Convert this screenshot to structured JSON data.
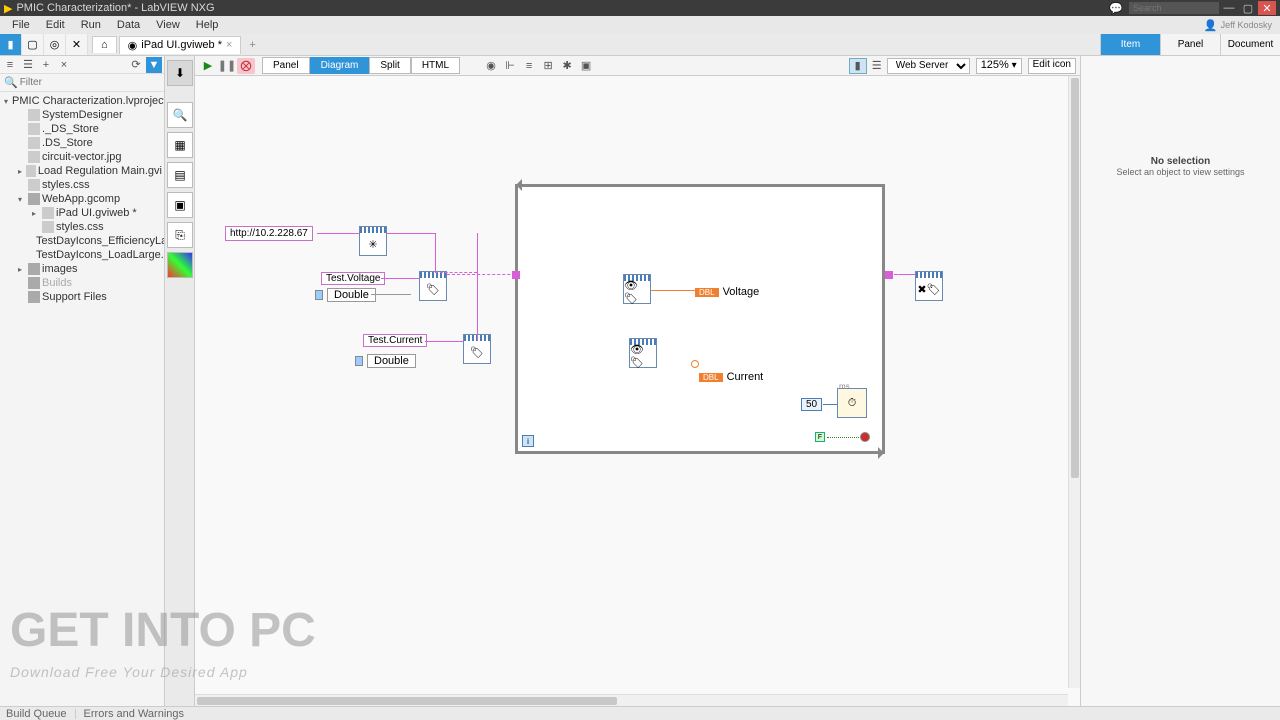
{
  "titlebar": {
    "title": "PMIC Characterization* - LabVIEW NXG",
    "search_placeholder": "Search"
  },
  "menubar": {
    "items": [
      "File",
      "Edit",
      "Run",
      "Data",
      "View",
      "Help"
    ],
    "user": "Jeff Kodosky"
  },
  "tabs": {
    "home_icon": "⌂",
    "items": [
      {
        "label": "iPad UI.gviweb *"
      }
    ]
  },
  "right_tabs": {
    "item": "Item",
    "panel": "Panel",
    "document": "Document"
  },
  "proj_filter_placeholder": "Filter",
  "tree": {
    "root": "PMIC Characterization.lvproject *",
    "items": [
      {
        "label": "SystemDesigner",
        "level": 2,
        "exp": false
      },
      {
        "label": "._DS_Store",
        "level": 2,
        "exp": false
      },
      {
        "label": ".DS_Store",
        "level": 2,
        "exp": false
      },
      {
        "label": "circuit-vector.jpg",
        "level": 2,
        "exp": false
      },
      {
        "label": "Load Regulation Main.gvi",
        "level": 2,
        "exp": true
      },
      {
        "label": "styles.css",
        "level": 2,
        "exp": false
      },
      {
        "label": "WebApp.gcomp",
        "level": 2,
        "exp": true,
        "open": true
      },
      {
        "label": "iPad UI.gviweb *",
        "level": 3,
        "exp": true
      },
      {
        "label": "styles.css",
        "level": 3,
        "exp": false
      },
      {
        "label": "TestDayIcons_EfficiencyLar...",
        "level": 3,
        "exp": false
      },
      {
        "label": "TestDayIcons_LoadLarge.png",
        "level": 3,
        "exp": false
      },
      {
        "label": "images",
        "level": 2,
        "exp": true
      },
      {
        "label": "Builds",
        "level": 2,
        "exp": false,
        "gray": true
      },
      {
        "label": "Support Files",
        "level": 2,
        "exp": false
      }
    ]
  },
  "canvastb": {
    "viewtabs": [
      "Panel",
      "Diagram",
      "Split",
      "HTML"
    ],
    "server": "Web Server",
    "zoom": "125%",
    "editicon": "Edit icon"
  },
  "diagram": {
    "url": "http://10.2.228.67",
    "voltage_label": "Test.Voltage",
    "voltage_type": "Double",
    "current_label": "Test.Current",
    "current_type": "Double",
    "voltage_ind": "Voltage",
    "current_ind": "Current",
    "ms_value": "50",
    "ms_label": "ms",
    "dbl_tag": "DBL",
    "bool_f": "F"
  },
  "inspector": {
    "heading": "No selection",
    "sub": "Select an object to view settings"
  },
  "status": {
    "queue": "Build Queue",
    "errors": "Errors and Warnings"
  },
  "watermark": {
    "big": "GET INTO PC",
    "sub": "Download Free Your Desired App"
  }
}
